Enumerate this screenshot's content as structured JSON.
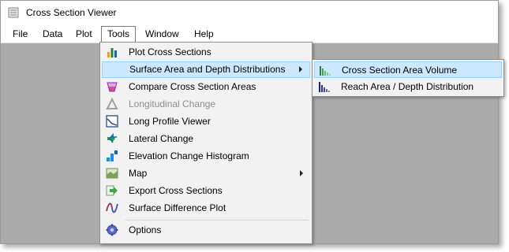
{
  "window": {
    "title": "Cross Section Viewer"
  },
  "menubar": {
    "items": [
      {
        "label": "File"
      },
      {
        "label": "Data"
      },
      {
        "label": "Plot"
      },
      {
        "label": "Tools"
      },
      {
        "label": "Window"
      },
      {
        "label": "Help"
      }
    ]
  },
  "tools_menu": {
    "items": [
      {
        "label": "Plot Cross Sections",
        "icon": "bar-chart-icon"
      },
      {
        "label": "Surface Area and Depth Distributions",
        "icon": "none",
        "highlighted": true,
        "submenu": true
      },
      {
        "label": "Compare Cross Section Areas",
        "icon": "compare-areas-icon"
      },
      {
        "label": "Longitudinal Change",
        "icon": "delta-icon",
        "disabled": true
      },
      {
        "label": "Long Profile Viewer",
        "icon": "profile-chart-icon"
      },
      {
        "label": "Lateral Change",
        "icon": "lateral-arrows-icon"
      },
      {
        "label": "Elevation Change Histogram",
        "icon": "histogram-icon"
      },
      {
        "label": "Map",
        "icon": "map-icon",
        "submenu": true
      },
      {
        "label": "Export Cross Sections",
        "icon": "export-arrow-icon"
      },
      {
        "label": "Surface Difference Plot",
        "icon": "wave-icon"
      },
      {
        "label": "Options",
        "icon": "gear-icon"
      }
    ]
  },
  "surface_submenu": {
    "items": [
      {
        "label": "Cross Section Area Volume",
        "icon": "green-bars-icon",
        "highlighted": true
      },
      {
        "label": "Reach Area / Depth Distribution",
        "icon": "blue-bars-icon"
      }
    ]
  },
  "colors": {
    "highlight_bg": "#cce8ff",
    "highlight_border": "#99d1ff",
    "workspace": "#ababab"
  }
}
